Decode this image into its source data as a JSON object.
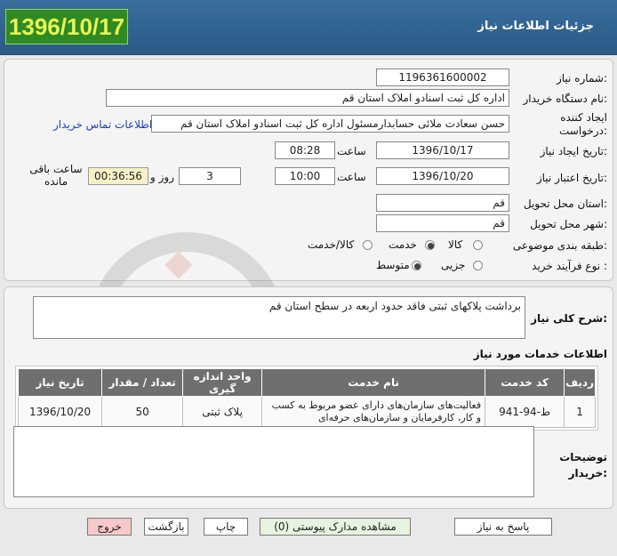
{
  "header": {
    "title": "جزئیات اطلاعات نیاز",
    "date": "1396/10/17"
  },
  "form": {
    "need_number_label": "شماره نیاز:",
    "need_number": "1196361600002",
    "buyer_org_label": "نام دستگاه خریدار:",
    "buyer_org": "اداره کل ثبت اسنادو املاک استان قم",
    "creator_label": "ایجاد کننده درخواست:",
    "creator": "حسن سعادت ملائی حسابدارمسئول اداره کل ثبت اسنادو املاک استان قم",
    "contact_link": "اطلاعات تماس خریدار",
    "announce_date_label": "تاریخ ایجاد نیاز:",
    "announce_date": "1396/10/17",
    "time_label": "ساعت",
    "announce_time": "08:28",
    "deadline_label": "تاریخ اعتبار نیاز:",
    "deadline_date": "1396/10/20",
    "deadline_time": "10:00",
    "days_remaining": "3",
    "days_and_label": "روز و",
    "time_remaining": "00:36:56",
    "time_remaining_label": "ساعت باقی مانده",
    "province_label": "استان محل تحویل:",
    "province": "قم",
    "city_label": "شهر محل تحویل:",
    "city": "قم",
    "category_label": "طبقه بندی موضوعی:",
    "category_options": [
      "کالا",
      "خدمت",
      "کالا/خدمت"
    ],
    "category_selected": "خدمت",
    "process_label": "نوع فرآیند خرید :",
    "process_options": [
      "جزیی",
      "متوسط"
    ],
    "process_selected": "متوسط"
  },
  "summary": {
    "label": "شرح کلی نیاز:",
    "text": "برداشت پلاکهای ثبتی فاقد حدود اربعه در سطح استان قم"
  },
  "services": {
    "title": "اطلاعات خدمات مورد نیاز",
    "columns": [
      "ردیف",
      "کد خدمت",
      "نام خدمت",
      "واحد اندازه گیری",
      "تعداد / مقدار",
      "تاریخ نیاز"
    ],
    "rows": [
      {
        "row": "1",
        "code": "ط-94-941",
        "name": "فعالیت‌های سازمان‌های دارای عضو مربوط به کسب و کار، کارفرمایان و سازمان‌های حرفه‌ای",
        "unit": "پلاک ثبتی",
        "qty": "50",
        "date": "1396/10/20"
      }
    ]
  },
  "buyer_notes": {
    "label": "توضیحات خریدار:",
    "text": ""
  },
  "buttons": {
    "reply": "پاسخ به نیاز",
    "attachments": "مشاهده مدارک پیوستی (0)",
    "print": "چاپ",
    "back": "بازگشت",
    "exit": "خروج"
  },
  "colors": {
    "header_bg": "#2f6090",
    "date_badge_bg": "#2f8a23",
    "date_badge_text": "#e8f552",
    "table_header_bg": "#6f6f6f",
    "timer_bg": "#f8f1c8",
    "exit_button_bg": "#f7c9c9",
    "attachments_button_bg": "#e6f3df"
  }
}
